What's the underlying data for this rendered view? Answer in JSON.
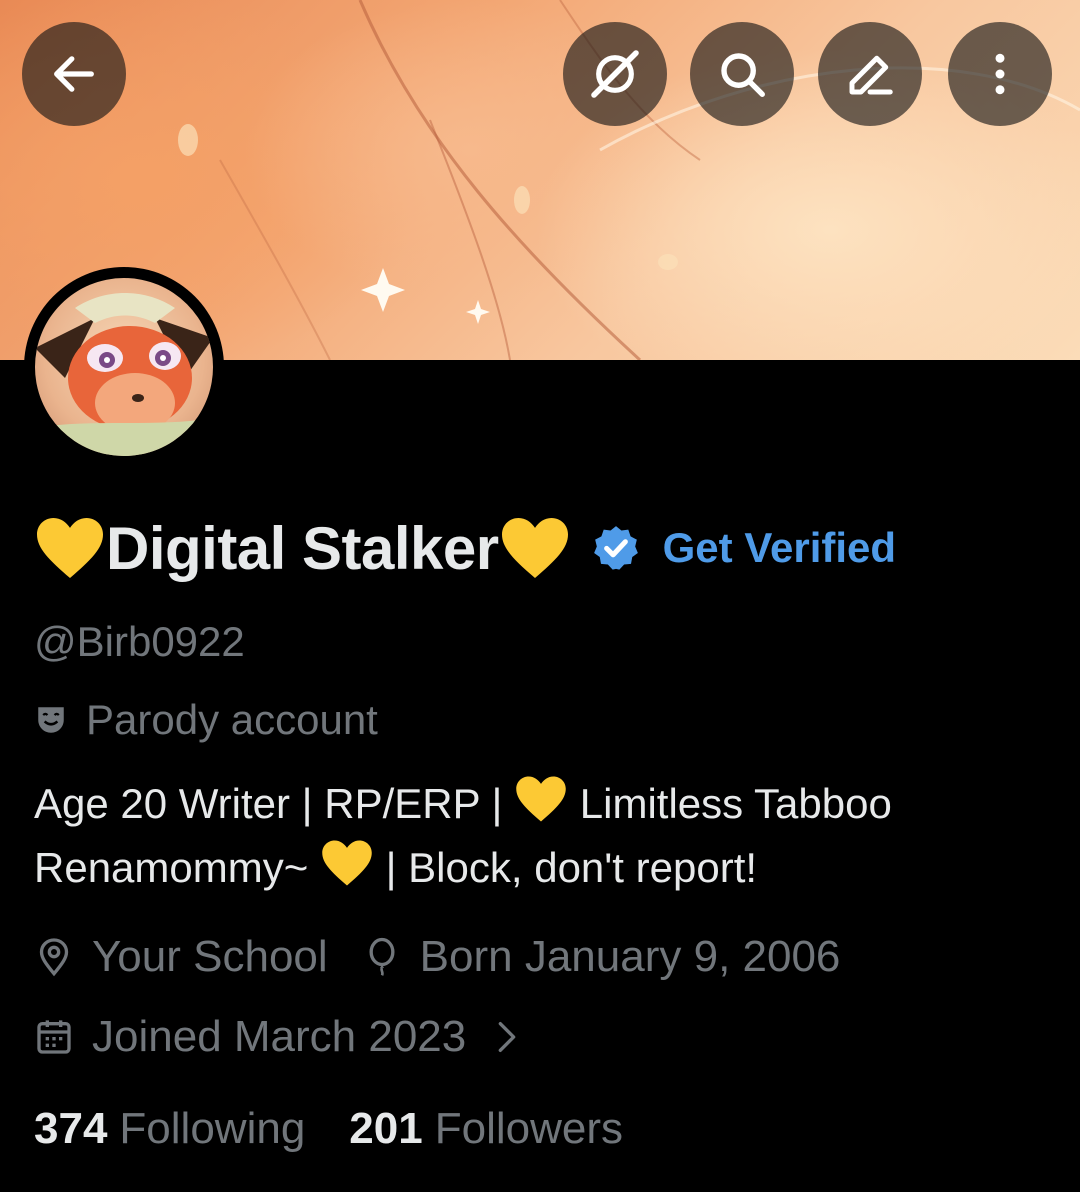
{
  "header": {
    "back_icon": "arrow-left-icon",
    "grok_icon": "grok-icon",
    "search_icon": "search-icon",
    "edit_icon": "edit-icon",
    "more_icon": "more-vertical-icon"
  },
  "profile": {
    "display_name": "Digital Stalker",
    "name_emoji": "yellow-heart",
    "verified_badge": "verified-badge-icon",
    "get_verified_label": "Get Verified",
    "handle": "@Birb0922",
    "parody_label": "Parody account",
    "bio_line1_a": "Age 20 Writer | RP/ERP | ",
    "bio_line1_b": " Limitless Tabboo",
    "bio_line2_a": "Renamommy~ ",
    "bio_line2_b": " | Block, don't report!",
    "location": "Your School",
    "birthday": "Born January 9, 2006",
    "joined": "Joined March 2023",
    "following_count": "374",
    "following_label": "Following",
    "followers_count": "201",
    "followers_label": "Followers"
  },
  "colors": {
    "background": "#000000",
    "text_primary": "#e7e9ea",
    "text_secondary": "#71767b",
    "accent_blue": "#4f9be8",
    "heart_yellow": "#fcc934"
  }
}
